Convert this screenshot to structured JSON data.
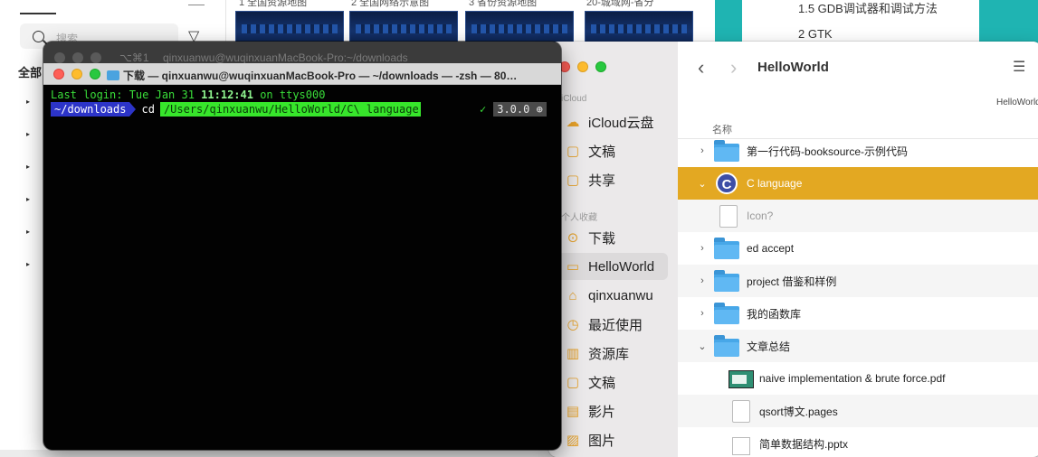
{
  "background_browser": {
    "search_placeholder": "搜索",
    "section_label": "全部"
  },
  "background_thumbs": {
    "captions": [
      "1 全国资源地图",
      "2 全国网络示意图",
      "3 省份资源地图",
      "20-城域网-省分"
    ]
  },
  "background_doc": {
    "lines": [
      "1.5  GDB调试器和调试方法",
      "2  GTK"
    ]
  },
  "terminal": {
    "ghost_shortcut": "⌥⌘1",
    "ghost_title": "qinxuanwu@wuqinxuanMacBook-Pro:~/downloads",
    "title": "下载 — qinxuanwu@wuqinxuanMacBook-Pro — ~/downloads — -zsh — 80…",
    "login_prefix": "Last login: Tue Jan 31 ",
    "login_time": "11:12:41",
    "login_suffix": " on ttys000",
    "prompt_dir": "~/downloads",
    "command": "cd",
    "argument": "/Users/qinxuanwu/HelloWorld/C\\ language",
    "status_check": "✓",
    "version": "3.0.0 ⊕"
  },
  "finder": {
    "title": "HelloWorld",
    "path_crumb": "HelloWorld",
    "column_name": "名称",
    "sidebar": {
      "section_icloud": "iCloud",
      "section_favorites": "个人收藏",
      "items": [
        {
          "label": "iCloud云盘",
          "icon": "☁",
          "section": "icloud"
        },
        {
          "label": "文稿",
          "icon": "▢",
          "section": "icloud"
        },
        {
          "label": "共享",
          "icon": "▢",
          "section": "icloud"
        },
        {
          "label": "下载",
          "icon": "⊙",
          "section": "fav"
        },
        {
          "label": "HelloWorld",
          "icon": "▭",
          "section": "fav",
          "selected": true
        },
        {
          "label": "qinxuanwu",
          "icon": "⌂",
          "section": "fav"
        },
        {
          "label": "最近使用",
          "icon": "◷",
          "section": "fav"
        },
        {
          "label": "资源库",
          "icon": "▥",
          "section": "fav"
        },
        {
          "label": "文稿",
          "icon": "▢",
          "section": "fav"
        },
        {
          "label": "影片",
          "icon": "▤",
          "section": "fav"
        },
        {
          "label": "图片",
          "icon": "▨",
          "section": "fav"
        }
      ]
    },
    "rows": [
      {
        "name": "第一行代码-booksource-示例代码",
        "kind": "folder",
        "chevron": "›"
      },
      {
        "name": "C language",
        "kind": "c",
        "chevron": "⌄",
        "selected": true
      },
      {
        "name": "Icon?",
        "kind": "doc",
        "chevron": "",
        "muted": true
      },
      {
        "name": "ed accept",
        "kind": "folder",
        "chevron": "›"
      },
      {
        "name": "project 借鉴和样例",
        "kind": "folder",
        "chevron": "›"
      },
      {
        "name": "我的函数库",
        "kind": "folder",
        "chevron": "›"
      },
      {
        "name": "文章总结",
        "kind": "folder",
        "chevron": "⌄"
      },
      {
        "name": "naive implementation & brute force.pdf",
        "kind": "pdf",
        "chevron": ""
      },
      {
        "name": "qsort博文.pages",
        "kind": "doc",
        "chevron": ""
      },
      {
        "name": "简单数据结构.pptx",
        "kind": "pptx",
        "chevron": ""
      }
    ]
  }
}
